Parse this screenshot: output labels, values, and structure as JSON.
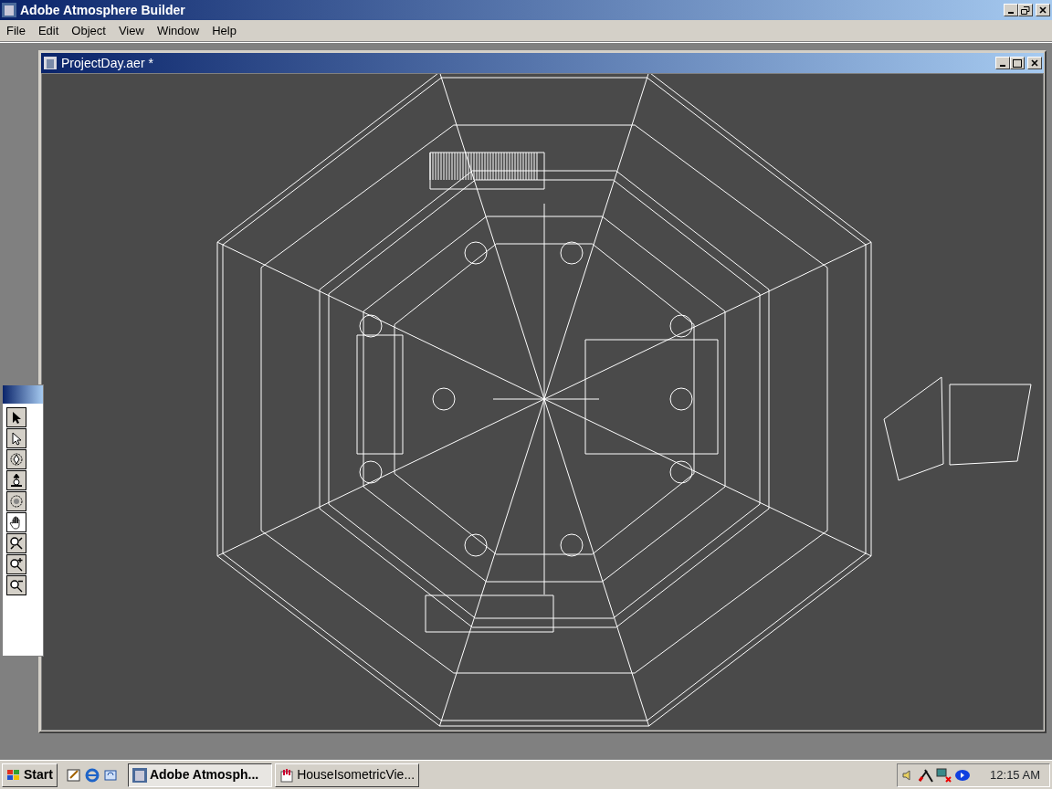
{
  "app_window": {
    "title": "Adobe Atmosphere Builder"
  },
  "menu": [
    "File",
    "Edit",
    "Object",
    "View",
    "Window",
    "Help"
  ],
  "document_window": {
    "title": "ProjectDay.aer *"
  },
  "toolbox": [
    {
      "kind": "arrow",
      "selected": false
    },
    {
      "kind": "hollow-arrow",
      "selected": false
    },
    {
      "kind": "rotate",
      "selected": false
    },
    {
      "kind": "lift",
      "selected": false
    },
    {
      "kind": "orbit",
      "selected": false
    },
    {
      "kind": "hand",
      "selected": true
    },
    {
      "kind": "zoom-fit",
      "selected": false
    },
    {
      "kind": "zoom-in",
      "selected": false
    },
    {
      "kind": "zoom-out",
      "selected": false
    }
  ],
  "taskbar": {
    "start": "Start",
    "tasks": [
      {
        "label": "Adobe Atmosph...",
        "selected": true
      },
      {
        "label": "HouseIsometricVie...",
        "selected": false
      }
    ],
    "clock": "12:15 AM"
  }
}
